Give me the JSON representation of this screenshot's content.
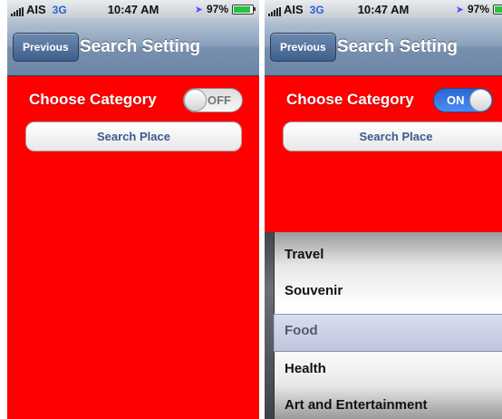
{
  "screens": [
    {
      "status": {
        "carrier": "AIS",
        "network": "3G",
        "time": "10:47 AM",
        "battery": "97%"
      },
      "nav": {
        "back_label": "Previous",
        "title": "Search Setting"
      },
      "category": {
        "label": "Choose Category",
        "toggle_state": "OFF"
      },
      "search_button": "Search Place"
    },
    {
      "status": {
        "carrier": "AIS",
        "network": "3G",
        "time": "10:47 AM",
        "battery": "97%"
      },
      "nav": {
        "back_label": "Previous",
        "title": "Search Setting"
      },
      "category": {
        "label": "Choose Category",
        "toggle_state": "ON"
      },
      "search_button": "Search Place",
      "picker": {
        "items": [
          "Travel",
          "Souvenir",
          "Food",
          "Health",
          "Art and Entertainment"
        ],
        "selected": "Food"
      }
    }
  ],
  "colors": {
    "background": "#ff0000",
    "toggle_on": "#2a67d2",
    "nav_bar": "#7890ae"
  }
}
